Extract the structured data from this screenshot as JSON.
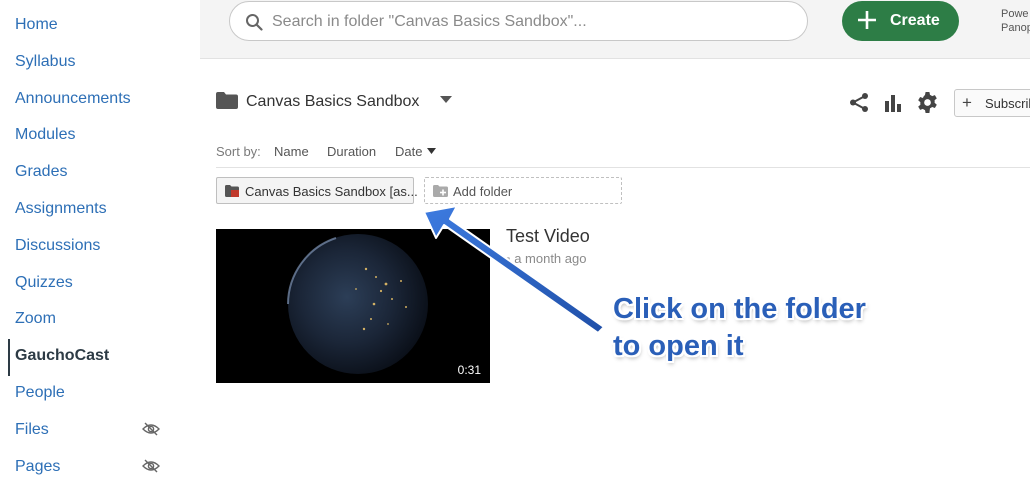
{
  "course_nav": {
    "items": [
      {
        "label": "Home"
      },
      {
        "label": "Syllabus"
      },
      {
        "label": "Announcements"
      },
      {
        "label": "Modules"
      },
      {
        "label": "Grades"
      },
      {
        "label": "Assignments"
      },
      {
        "label": "Discussions"
      },
      {
        "label": "Quizzes"
      },
      {
        "label": "Zoom"
      },
      {
        "label": "GauchoCast",
        "active": true
      },
      {
        "label": "People"
      },
      {
        "label": "Files",
        "hidden_icon": "eye-slash-icon"
      },
      {
        "label": "Pages",
        "hidden_icon": "eye-slash-icon"
      }
    ]
  },
  "search": {
    "placeholder": "Search in folder \"Canvas Basics Sandbox\"...",
    "value": ""
  },
  "toolbar": {
    "create_label": "Create",
    "powered_line1": "Powe",
    "powered_line2": "Panop"
  },
  "folder": {
    "title": "Canvas Basics Sandbox",
    "share_icon": "share-icon",
    "stats_icon": "bar-chart-icon",
    "settings_icon": "gear-icon",
    "subscribe_label": "Subscrib"
  },
  "sort": {
    "label": "Sort by:",
    "options": [
      "Name",
      "Duration",
      "Date"
    ],
    "active": "Date"
  },
  "subfolders": {
    "items": [
      {
        "label": "Canvas Basics Sandbox [as..."
      }
    ],
    "add_label": "Add folder"
  },
  "videos": [
    {
      "title": "Test Video",
      "date": "a month ago",
      "duration": "0:31"
    }
  ],
  "annotation": {
    "line1": "Click on the folder",
    "line2": "to open it"
  },
  "colors": {
    "nav_link": "#2d6fb6",
    "create_green": "#2d7d46",
    "annotation_blue": "#2a5fb8",
    "folder_red": "#c0392b"
  }
}
